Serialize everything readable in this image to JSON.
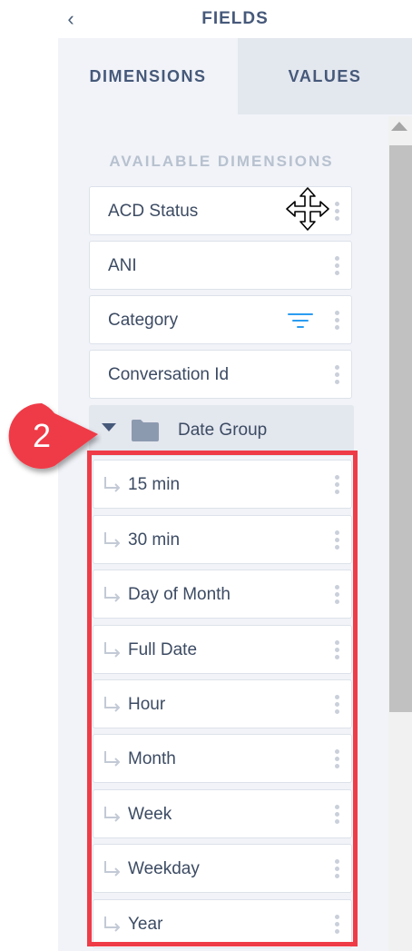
{
  "header": {
    "back_icon": "chevron-left-icon",
    "title": "FIELDS"
  },
  "tabs": [
    {
      "label": "DIMENSIONS",
      "active": true
    },
    {
      "label": "VALUES",
      "active": false
    }
  ],
  "section_title": "AVAILABLE DIMENSIONS",
  "dimensions": [
    {
      "label": "ACD Status"
    },
    {
      "label": "ANI"
    },
    {
      "label": "Category",
      "has_filter": true
    },
    {
      "label": "Conversation Id"
    }
  ],
  "date_group": {
    "label": "Date Group",
    "expanded": true,
    "items": [
      {
        "label": "15 min"
      },
      {
        "label": "30 min"
      },
      {
        "label": "Day of Month"
      },
      {
        "label": "Full Date"
      },
      {
        "label": "Hour"
      },
      {
        "label": "Month"
      },
      {
        "label": "Week"
      },
      {
        "label": "Weekday"
      },
      {
        "label": "Year"
      }
    ]
  },
  "callout": {
    "number": "2",
    "color": "#ef3b47"
  },
  "colors": {
    "text": "#3c4b63",
    "heading": "#46597a",
    "filter": "#2b9cf2",
    "highlight": "#ef3b47"
  }
}
